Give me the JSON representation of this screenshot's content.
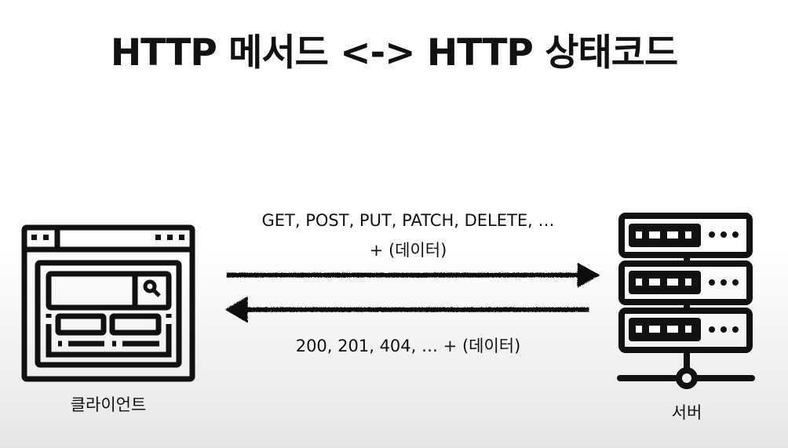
{
  "title": "HTTP 메서드 <-> HTTP 상태코드",
  "request": {
    "methods": "GET, POST, PUT, PATCH, DELETE, …",
    "data": "+ (데이터)"
  },
  "response": {
    "codes": "200, 201, 404, … + (데이터)"
  },
  "client": {
    "label": "클라이언트",
    "icon": "browser-window-icon"
  },
  "server": {
    "label": "서버",
    "icon": "server-rack-icon"
  },
  "colors": {
    "ink": "#111111",
    "background": "#ffffff"
  }
}
